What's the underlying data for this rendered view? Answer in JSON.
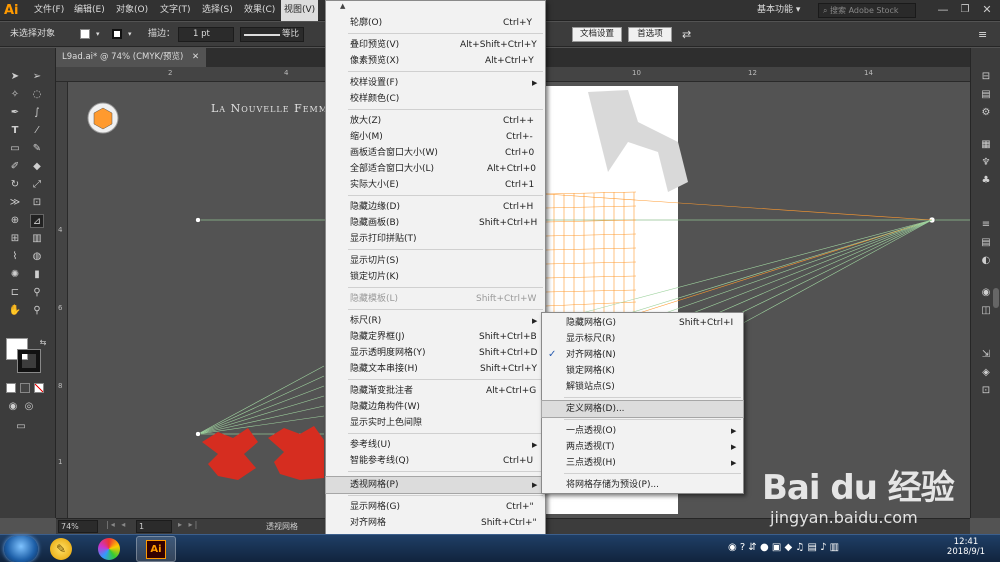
{
  "menubar": {
    "logo": "Ai",
    "items": [
      "文件(F)",
      "编辑(E)",
      "对象(O)",
      "文字(T)",
      "选择(S)",
      "效果(C)",
      "视图(V)"
    ],
    "workspace": "基本功能",
    "search_placeholder": "搜索 Adobe Stock",
    "colors": {
      "bar": "#323232",
      "logo": "#ff9a00"
    }
  },
  "ctrlbar": {
    "no_selection": "未选择对象",
    "stroke_label": "描边：",
    "stroke_value": "1 pt",
    "stroke_profile": "等比",
    "doc_setup": "文档设置",
    "prefs": "首选项"
  },
  "document": {
    "tab_title": "L9ad.ai* @ 74% (CMYK/预览)",
    "art_title": "La Nouvelle Femm",
    "ruler_top": [
      "2",
      "4",
      "6",
      "8",
      "10",
      "12",
      "14"
    ],
    "ruler_left": [
      "4",
      "6",
      "8",
      "1"
    ],
    "colors": {
      "grid": "#ff9a2e",
      "lines": "#9fd39f",
      "red": "#d62d20"
    }
  },
  "view_menu": {
    "items": [
      {
        "label": "轮廓(O)",
        "shortcut": "Ctrl+Y"
      },
      {
        "label": "叠印预览(V)",
        "shortcut": "Alt+Shift+Ctrl+Y"
      },
      {
        "label": "像素预览(X)",
        "shortcut": "Alt+Ctrl+Y"
      },
      {
        "label": "校样设置(F)",
        "shortcut": ""
      },
      {
        "label": "校样颜色(C)",
        "shortcut": ""
      },
      {
        "label": "放大(Z)",
        "shortcut": "Ctrl++"
      },
      {
        "label": "缩小(M)",
        "shortcut": "Ctrl+-"
      },
      {
        "label": "画板适合窗口大小(W)",
        "shortcut": "Ctrl+0"
      },
      {
        "label": "全部适合窗口大小(L)",
        "shortcut": "Alt+Ctrl+0"
      },
      {
        "label": "实际大小(E)",
        "shortcut": "Ctrl+1"
      },
      {
        "label": "隐藏边缘(D)",
        "shortcut": "Ctrl+H"
      },
      {
        "label": "隐藏画板(B)",
        "shortcut": "Shift+Ctrl+H"
      },
      {
        "label": "显示打印拼贴(T)",
        "shortcut": ""
      },
      {
        "label": "显示切片(S)",
        "shortcut": ""
      },
      {
        "label": "锁定切片(K)",
        "shortcut": ""
      },
      {
        "label": "隐藏模板(L)",
        "shortcut": "Shift+Ctrl+W"
      },
      {
        "label": "标尺(R)",
        "shortcut": ""
      },
      {
        "label": "隐藏定界框(J)",
        "shortcut": "Shift+Ctrl+B"
      },
      {
        "label": "显示透明度网格(Y)",
        "shortcut": "Shift+Ctrl+D"
      },
      {
        "label": "隐藏文本串接(H)",
        "shortcut": "Shift+Ctrl+Y"
      },
      {
        "label": "隐藏渐变批注者",
        "shortcut": "Alt+Ctrl+G"
      },
      {
        "label": "隐藏边角构件(W)",
        "shortcut": ""
      },
      {
        "label": "显示实时上色间隙",
        "shortcut": ""
      },
      {
        "label": "参考线(U)",
        "shortcut": ""
      },
      {
        "label": "智能参考线(Q)",
        "shortcut": "Ctrl+U"
      },
      {
        "label": "透视网格(P)",
        "shortcut": ""
      },
      {
        "label": "显示网格(G)",
        "shortcut": "Ctrl+\""
      },
      {
        "label": "对齐网格",
        "shortcut": "Shift+Ctrl+\""
      }
    ]
  },
  "perspective_submenu": {
    "items": [
      {
        "label": "隐藏网格(G)",
        "shortcut": "Shift+Ctrl+I"
      },
      {
        "label": "显示标尺(R)",
        "shortcut": ""
      },
      {
        "label": "对齐网格(N)",
        "shortcut": ""
      },
      {
        "label": "锁定网格(K)",
        "shortcut": ""
      },
      {
        "label": "解锁站点(S)",
        "shortcut": ""
      },
      {
        "label": "定义网格(D)...",
        "shortcut": ""
      },
      {
        "label": "一点透视(O)",
        "shortcut": ""
      },
      {
        "label": "两点透视(T)",
        "shortcut": ""
      },
      {
        "label": "三点透视(H)",
        "shortcut": ""
      },
      {
        "label": "将网格存储为预设(P)...",
        "shortcut": ""
      }
    ]
  },
  "statusbar": {
    "zoom": "74%",
    "page": "1",
    "info": "透视网格"
  },
  "watermark": {
    "brand": "Bai du 经验",
    "url": "jingyan.baidu.com"
  },
  "taskbar": {
    "time": "12:41",
    "date": "2018/9/1",
    "app_label": "Ai"
  }
}
